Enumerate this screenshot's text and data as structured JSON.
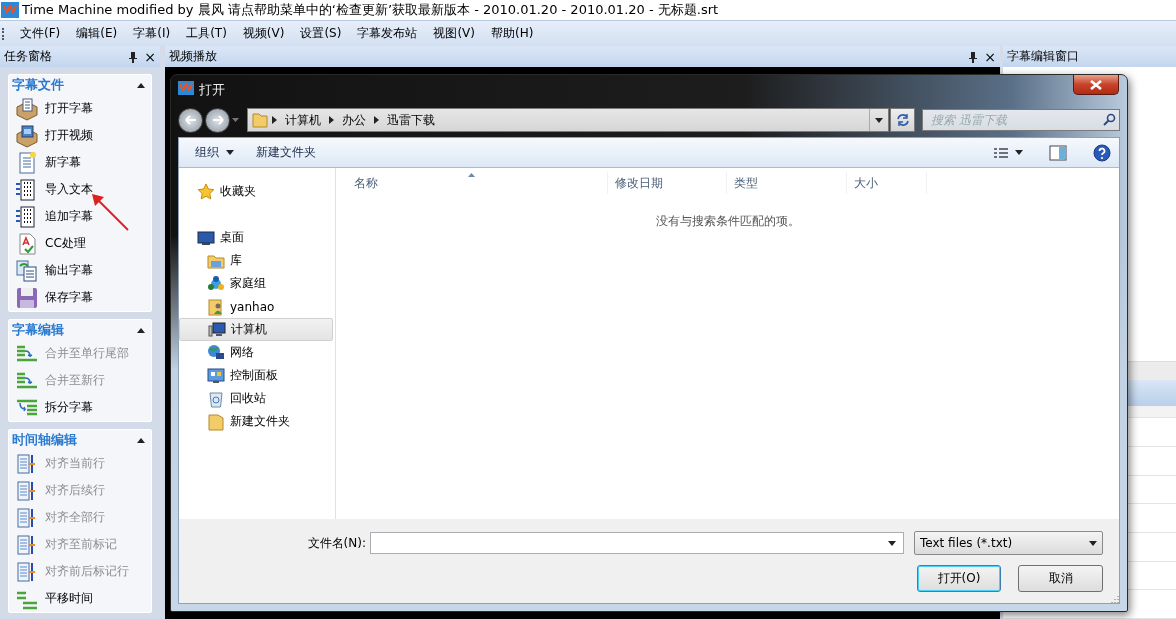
{
  "window": {
    "title": "Time Machine modified by 晨风 请点帮助菜单中的‘检查更新’获取最新版本 - 2010.01.20 - 2010.01.20 - 无标题.srt"
  },
  "menu": [
    "文件(F)",
    "编辑(E)",
    "字幕(I)",
    "工具(T)",
    "视频(V)",
    "设置(S)",
    "字幕发布站",
    "视图(V)",
    "帮助(H)"
  ],
  "task_pane": {
    "title": "任务窗格",
    "close": "×",
    "groups": [
      {
        "title": "字幕文件",
        "expanded": true,
        "items": [
          {
            "label": "打开字幕",
            "kind": "package",
            "disabled": false
          },
          {
            "label": "打开视频",
            "kind": "film-package",
            "disabled": false
          },
          {
            "label": "新字幕",
            "kind": "document",
            "disabled": false
          },
          {
            "label": "导入文本",
            "kind": "dotted-page",
            "disabled": false
          },
          {
            "label": "追加字幕",
            "kind": "dotted-page",
            "disabled": false
          },
          {
            "label": "CC处理",
            "kind": "check-page",
            "disabled": false
          },
          {
            "label": "输出字幕",
            "kind": "pages",
            "disabled": false
          },
          {
            "label": "保存字幕",
            "kind": "floppy",
            "disabled": false
          }
        ]
      },
      {
        "title": "字幕编辑",
        "expanded": true,
        "items": [
          {
            "label": "合并至单行尾部",
            "kind": "merge",
            "disabled": true
          },
          {
            "label": "合并至新行",
            "kind": "merge",
            "disabled": true
          },
          {
            "label": "拆分字幕",
            "kind": "split",
            "disabled": false
          }
        ]
      },
      {
        "title": "时间轴编辑",
        "expanded": true,
        "items": [
          {
            "label": "对齐当前行",
            "kind": "align",
            "disabled": true
          },
          {
            "label": "对齐后续行",
            "kind": "align",
            "disabled": true
          },
          {
            "label": "对齐全部行",
            "kind": "align",
            "disabled": true
          },
          {
            "label": "对齐至前标记",
            "kind": "align",
            "disabled": true
          },
          {
            "label": "对齐前后标记行",
            "kind": "align",
            "disabled": true
          },
          {
            "label": "平移时间",
            "kind": "shift",
            "disabled": false
          }
        ]
      }
    ]
  },
  "video_panel": {
    "title": "视频播放",
    "close": "×"
  },
  "edit_panel": {
    "title": "字幕编辑窗口"
  },
  "dialog": {
    "title": "打开",
    "breadcrumb": [
      "计算机",
      "办公",
      "迅雷下载"
    ],
    "search": {
      "placeholder": "搜索 迅雷下载"
    },
    "toolbar": [
      {
        "label": "组织",
        "kind": "menu"
      },
      {
        "label": "新建文件夹",
        "kind": "button"
      }
    ],
    "nav": [
      {
        "label": "收藏夹",
        "kind": "star",
        "selected": false
      },
      {
        "label": "桌面",
        "kind": "desktop",
        "selected": false,
        "children": [
          {
            "label": "库",
            "kind": "library",
            "selected": false
          },
          {
            "label": "家庭组",
            "kind": "homegroup",
            "selected": false
          },
          {
            "label": "yanhao",
            "kind": "user",
            "selected": false
          },
          {
            "label": "计算机",
            "kind": "computer",
            "selected": true
          },
          {
            "label": "网络",
            "kind": "network",
            "selected": false
          },
          {
            "label": "控制面板",
            "kind": "control-panel",
            "selected": false
          },
          {
            "label": "回收站",
            "kind": "recycle-bin",
            "selected": false
          },
          {
            "label": "新建文件夹",
            "kind": "folder",
            "selected": false
          }
        ]
      }
    ],
    "columns": [
      {
        "label": "名称",
        "sorted": true
      },
      {
        "label": "修改日期",
        "sorted": false
      },
      {
        "label": "类型",
        "sorted": false
      },
      {
        "label": "大小",
        "sorted": false
      }
    ],
    "empty_message": "没有与搜索条件匹配的项。",
    "filename": {
      "label": "文件名(N):"
    },
    "filter": "Text files (*.txt)",
    "buttons": [
      {
        "label": "打开(O)",
        "default": true
      },
      {
        "label": "取消",
        "default": false
      }
    ]
  }
}
